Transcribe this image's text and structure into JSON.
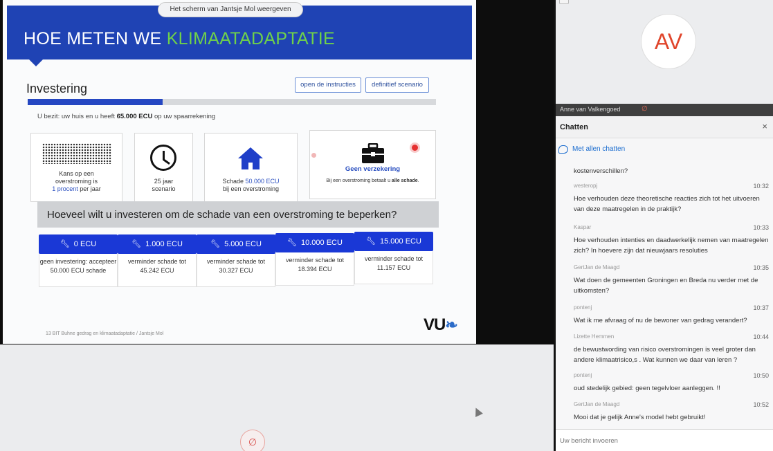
{
  "share_label": "Het scherm van Jantsje Mol weergeven",
  "slide": {
    "title_part1": "HOE METEN WE ",
    "title_part2": "KLIMAATADAPTATIE",
    "section_heading": "Investering",
    "btn_instructions": "open de instructies",
    "btn_scenario": "definitief scenario",
    "progress_fraction": 0.33,
    "assets_prefix": "U bezit: uw huis en u heeft ",
    "assets_amount": "65.000 ECU",
    "assets_suffix": " op uw spaarrekening",
    "card_risk": {
      "line1": "Kans op een",
      "line2": "overstroming is",
      "line3_blue": "1 procent",
      "line3_rest": " per jaar"
    },
    "card_years": {
      "line1": "25 jaar",
      "line2": "scenario"
    },
    "card_damage": {
      "line1_prefix": "Schade ",
      "line1_amount": "50.000 ECU",
      "line2": "bij een overstroming"
    },
    "card_insurance": {
      "title": "Geen verzekering",
      "line_prefix": "Bij een overstroming betaalt u ",
      "line_bold": "alle schade",
      "line_suffix": "."
    },
    "question": "Hoeveel wilt u investeren om de schade van een overstroming te beperken?",
    "options": [
      {
        "label": "0 ECU",
        "desc": "geen investering: accepteer 50.000 ECU schade"
      },
      {
        "label": "1.000 ECU",
        "desc": "verminder schade tot 45.242 ECU"
      },
      {
        "label": "5.000 ECU",
        "desc": "verminder schade tot 30.327 ECU"
      },
      {
        "label": "10.000 ECU",
        "desc": "verminder schade tot 18.394 ECU"
      },
      {
        "label": "15.000 ECU",
        "desc": "verminder schade tot 11.157 ECU"
      }
    ],
    "footer_note": "13   BIT Buhne gedrag en klimaatadaptatie / Jantsje Mol",
    "logo_text": "VU"
  },
  "video": {
    "initials": "AV",
    "name": "Anne van Valkengoed"
  },
  "chat": {
    "title": "Chatten",
    "close": "×",
    "recipient": "Met allen chatten",
    "input_placeholder": "Uw bericht invoeren",
    "messages": [
      {
        "sender": "",
        "time": "",
        "text": "kostenverschillen?"
      },
      {
        "sender": "westeropj",
        "time": "10:32",
        "text": "Hoe verhouden deze theoretische reacties zich tot het uitvoeren van deze maatregelen in de praktijk?"
      },
      {
        "sender": "Kaspar",
        "time": "10:33",
        "text": "Hoe verhouden intenties en daadwerkelijk nemen van maatregelen zich? In hoevere zijn dat nieuwjaars resoluties"
      },
      {
        "sender": "GertJan de Maagd",
        "time": "10:35",
        "text": "Wat doen de gemeenten Groningen en Breda nu verder met de uitkomsten?"
      },
      {
        "sender": "pontenj",
        "time": "10:37",
        "text": "Wat ik me afvraag of nu de bewoner van gedrag verandert?"
      },
      {
        "sender": "Lizette Hemmen",
        "time": "10:44",
        "text": "de bewustwording van risico overstromingen is veel groter dan andere klimaatrisico,s . Wat kunnen we daar van leren ?"
      },
      {
        "sender": "pontenj",
        "time": "10:50",
        "text": "oud stedelijk gebied: geen tegelvloer aanleggen. !!"
      },
      {
        "sender": "GertJan de Maagd",
        "time": "10:52",
        "text": "Mooi dat je gelijk Anne's model hebt gebruikt!"
      }
    ]
  }
}
